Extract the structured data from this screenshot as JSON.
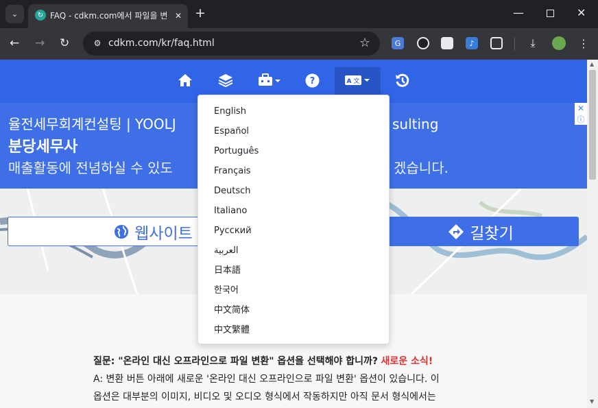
{
  "browser": {
    "tab_title": "FAQ - cdkm.com에서 파일을 변",
    "url": "cdkm.com/kr/faq.html",
    "colors": {
      "frame": "#202124",
      "toolbar": "#35363a"
    }
  },
  "site_nav": {
    "color": "#3165e5",
    "icons": [
      "home-icon",
      "layers-icon",
      "toolbox-icon",
      "help-icon",
      "language-icon",
      "history-icon"
    ]
  },
  "ad": {
    "line1": "율전세무회계컨설팅 | YOOLJ",
    "line1_tail": "sulting",
    "line2": "분당세무사",
    "line3": "매출활동에 전념하실 수 있도",
    "line3_tail": "겠습니다.",
    "website_label": "웹사이트",
    "directions_label": "길찾기"
  },
  "language_menu": {
    "items": [
      "English",
      "Español",
      "Português",
      "Français",
      "Deutsch",
      "Italiano",
      "Русский",
      "العربية",
      "日本語",
      "한국어",
      "中文简体",
      "中文繁體"
    ]
  },
  "faq": {
    "question": "질문: \"온라인 대신 오프라인으로 파일 변환\" 옵션을 선택해야 합니까?",
    "new_badge": "새로운 소식!",
    "answer_line1": "A: 변환 버튼 아래에 새로운 '온라인 대신 오프라인으로 파일 변환' 옵션이 있습니다. 이",
    "answer_line2": "옵션은 대부분의 이미지, 비디오 및 오디오 형식에서 작동하지만 아직 문서 형식에서는"
  }
}
